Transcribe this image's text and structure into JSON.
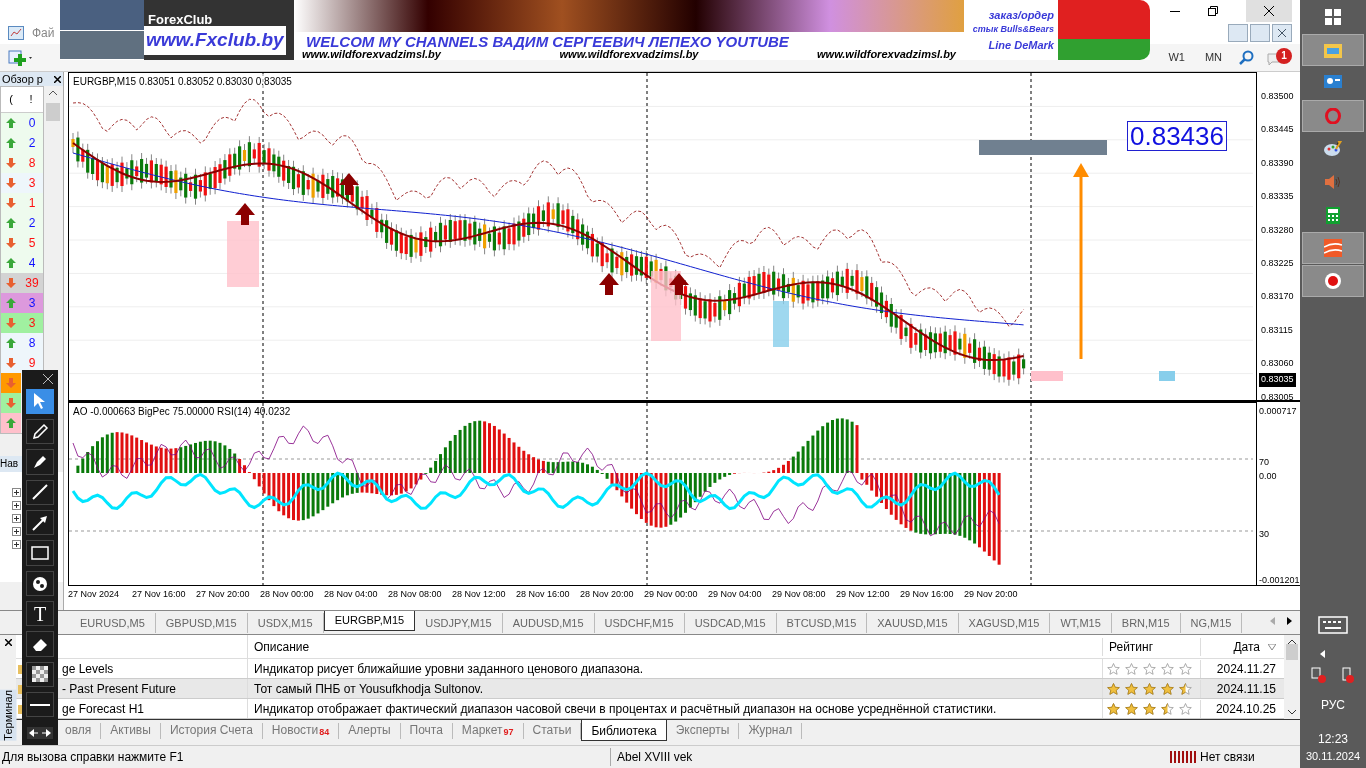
{
  "menu": [
    "Фай"
  ],
  "banner": {
    "logo": "ForexClub",
    "site": "www.Fxclub.by",
    "headline": "WELCOM MY CHANNELS ВАДИМ СЕРГЕЕВИЧ ЛЕПЕХО YOUTUBE",
    "links": [
      "www.wildforexvadzimsl.by",
      "www.wildforexvadzimsl.by",
      "www.wildforexvadzimsl.by"
    ],
    "legend": [
      "заказ/ордер",
      "стык Bulls&Bears",
      "Line DeMark"
    ]
  },
  "toolbar": {
    "timeframes": [
      "W1",
      "MN"
    ],
    "notifications": "1"
  },
  "market_watch": {
    "title": "Обзор р",
    "columns": [
      "(",
      "!"
    ],
    "rows": [
      {
        "kind": "up",
        "value": "0",
        "color": "#eefbee"
      },
      {
        "kind": "up",
        "value": "2",
        "color": "#eefbee"
      },
      {
        "kind": "down",
        "value": "8",
        "color": "#eefbee"
      },
      {
        "kind": "down",
        "value": "3",
        "color": "#eef6fb"
      },
      {
        "kind": "down",
        "value": "1",
        "color": "#eefbee"
      },
      {
        "kind": "up",
        "value": "2",
        "color": "#eefbee"
      },
      {
        "kind": "down",
        "value": "5",
        "color": "#eefbee"
      },
      {
        "kind": "up",
        "value": "4",
        "color": "#eefbee"
      },
      {
        "kind": "down",
        "value": "39",
        "color": "#d3d3d3"
      },
      {
        "kind": "up",
        "value": "3",
        "color": "#dd99dd"
      },
      {
        "kind": "down",
        "value": "3",
        "color": "#a0f0a0"
      },
      {
        "kind": "up",
        "value": "8",
        "color": "#eef6fb"
      },
      {
        "kind": "down",
        "value": "9",
        "color": "#eef6fb"
      },
      {
        "kind": "down",
        "color": "#ff9900"
      },
      {
        "kind": "down",
        "color": "#a0f0a0"
      },
      {
        "kind": "up",
        "color": "#ffc0cb"
      }
    ]
  },
  "navigator": {
    "title": "Нав"
  },
  "drawing_tools": [
    {
      "kind": "cursor",
      "selected": true
    },
    {
      "kind": "pencil",
      "selected": false
    },
    {
      "kind": "marker",
      "selected": false
    },
    {
      "kind": "line",
      "selected": false
    },
    {
      "kind": "arrow",
      "selected": false
    },
    {
      "kind": "rectangle",
      "selected": false
    },
    {
      "kind": "stamp",
      "selected": false
    },
    {
      "kind": "text",
      "selected": false,
      "label": "T"
    },
    {
      "kind": "eraser",
      "selected": false
    },
    {
      "kind": "checker",
      "selected": false
    },
    {
      "kind": "hline",
      "selected": false
    }
  ],
  "chart": {
    "title": "EURGBP,M15  0.83051 0.83052 0.83030 0.83035",
    "target_label": "0.83436",
    "price_axis": [
      "0.83500",
      "0.83445",
      "0.83390",
      "0.83335",
      "0.83280",
      "0.83225",
      "0.83170",
      "0.83115",
      "0.83060",
      "0.83005"
    ],
    "current_price": "0.83035",
    "indicator": {
      "title": "AO -0.000663  BigPec 75.00000  RSI(14) 40.0232",
      "axis": [
        "0.000717",
        "70",
        "0.00",
        "30",
        "-0.001201"
      ]
    },
    "time_axis": [
      "27 Nov 2024",
      "27 Nov 16:00",
      "27 Nov 20:00",
      "28 Nov 00:00",
      "28 Nov 04:00",
      "28 Nov 08:00",
      "28 Nov 12:00",
      "28 Nov 16:00",
      "28 Nov 20:00",
      "29 Nov 00:00",
      "29 Nov 04:00",
      "29 Nov 08:00",
      "29 Nov 12:00",
      "29 Nov 16:00",
      "29 Nov 20:00"
    ]
  },
  "symbol_tabs": [
    {
      "label": "EURUSD,M5",
      "selected": false
    },
    {
      "label": "GBPUSD,M15",
      "selected": false
    },
    {
      "label": "USDX,M15",
      "selected": false
    },
    {
      "label": "EURGBP,M15",
      "selected": true
    },
    {
      "label": "USDJPY,M15",
      "selected": false
    },
    {
      "label": "AUDUSD,M15",
      "selected": false
    },
    {
      "label": "USDCHF,M15",
      "selected": false
    },
    {
      "label": "USDCAD,M15",
      "selected": false
    },
    {
      "label": "BTCUSD,M15",
      "selected": false
    },
    {
      "label": "XAUUSD,M15",
      "selected": false
    },
    {
      "label": "XAGUSD,M15",
      "selected": false
    },
    {
      "label": "WT,M15",
      "selected": false
    },
    {
      "label": "BRN,M15",
      "selected": false
    },
    {
      "label": "NG,M15",
      "selected": false
    }
  ],
  "terminal": {
    "side_label": "Терминал",
    "columns": [
      "Описание",
      "Рейтинг",
      "Дата"
    ],
    "rows": [
      {
        "name": "ge Levels",
        "description": "Индикатор рисует ближайшие уровни заданного ценового диапазона.",
        "stars": 0,
        "date": "2024.11.27",
        "selected": false
      },
      {
        "name": "- Past Present Future",
        "description": "Тот самый ПНБ от Yousufkhodja Sultonov.",
        "stars": 4.5,
        "date": "2024.11.15",
        "selected": true
      },
      {
        "name": "ge Forecast H1",
        "description": "Индикатор отображает фактический диапазон часовой свечи в процентах и расчётный диапазон на основе усреднённой статистики.",
        "stars": 3.5,
        "date": "2024.10.25",
        "selected": false
      }
    ],
    "tabs": [
      {
        "label": "овля",
        "selected": false
      },
      {
        "label": "Активы",
        "selected": false
      },
      {
        "label": "История Счета",
        "selected": false
      },
      {
        "label": "Новости",
        "badge": "84",
        "selected": false
      },
      {
        "label": "Алерты",
        "selected": false
      },
      {
        "label": "Почта",
        "selected": false
      },
      {
        "label": "Маркет",
        "badge": "97",
        "selected": false
      },
      {
        "label": "Статьи",
        "selected": false
      },
      {
        "label": "Библиотека",
        "selected": true
      },
      {
        "label": "Эксперты",
        "selected": false
      },
      {
        "label": "Журнал",
        "selected": false
      }
    ]
  },
  "status_bar": {
    "help": "Для вызова справки нажмите F1",
    "profile": "Abel XVIII vek",
    "connection": "Нет связи"
  },
  "taskbar": {
    "apps": [
      {
        "kind": "windows",
        "active": false
      },
      {
        "kind": "explorer",
        "active": true
      },
      {
        "kind": "contacts",
        "active": false
      },
      {
        "kind": "opera",
        "active": true
      },
      {
        "kind": "paint",
        "active": false
      },
      {
        "kind": "speaker",
        "active": false
      },
      {
        "kind": "calculator",
        "active": false
      },
      {
        "kind": "trading",
        "active": true
      },
      {
        "kind": "record",
        "active": true
      }
    ],
    "language": "РУС",
    "time": "12:23",
    "date": "30.11.2024"
  }
}
